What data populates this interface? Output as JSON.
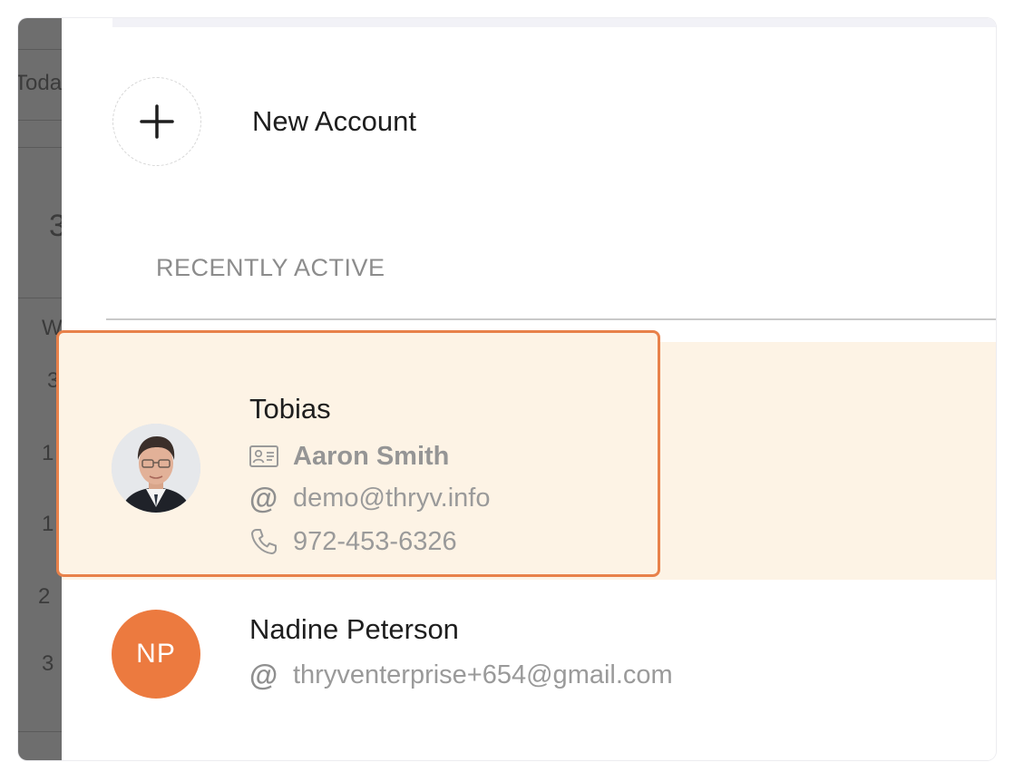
{
  "backdrop": {
    "fragments": [
      "Toda",
      "3",
      "W",
      "3",
      "1",
      "1",
      "2",
      "3"
    ]
  },
  "new_account": {
    "label": "New Account",
    "icon": "plus-icon"
  },
  "recent": {
    "section_label": "RECENTLY ACTIVE",
    "contacts": [
      {
        "name": "Tobias",
        "contact_person": "Aaron Smith",
        "email": "demo@thryv.info",
        "phone": "972-453-6326",
        "avatar": "photo",
        "selected": true
      },
      {
        "name": "Nadine Peterson",
        "initials": "NP",
        "email": "thryventerprise+654@gmail.com",
        "avatar_color": "#ec7a3f"
      }
    ]
  },
  "colors": {
    "accent": "#ec7a3f",
    "highlight": "#fdf3e5",
    "selection_border": "#e8814a"
  }
}
